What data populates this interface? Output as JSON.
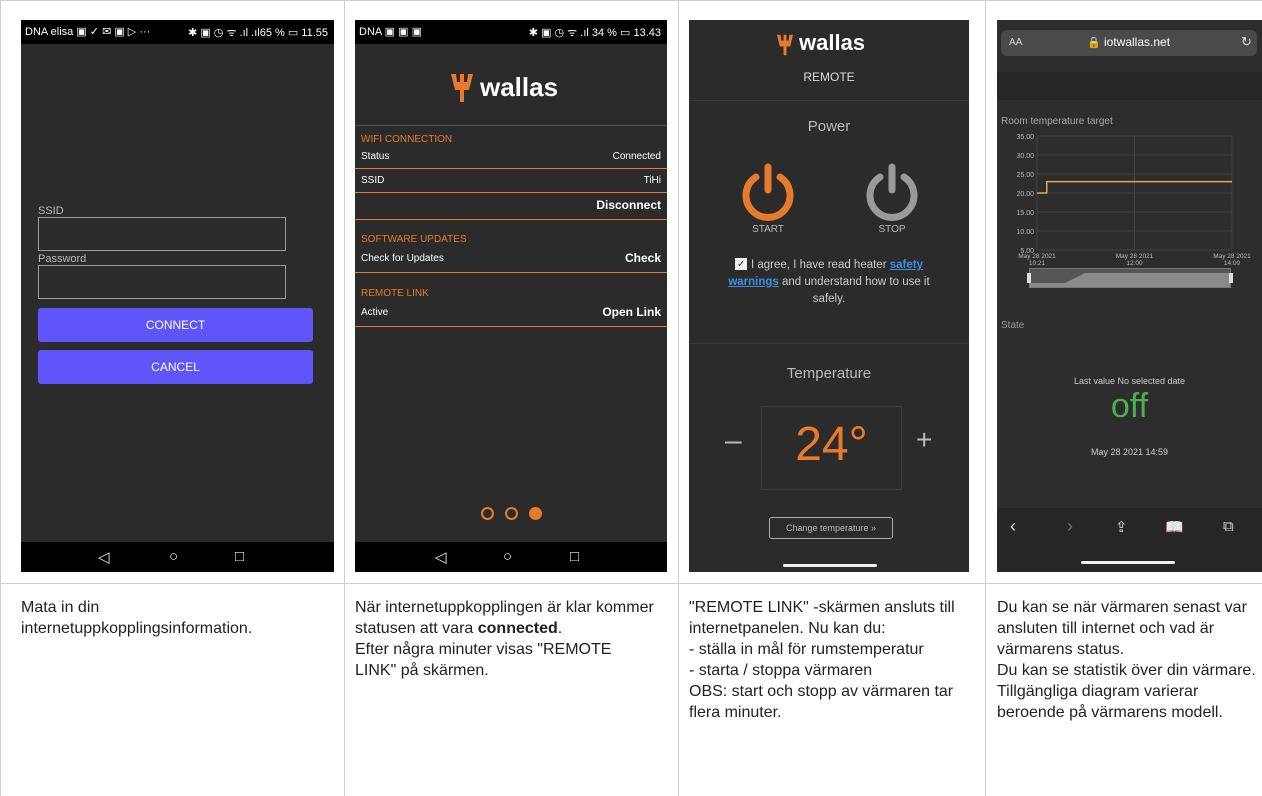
{
  "phone1": {
    "status_left": "DNA elisa ▣ ✓ ✉ ▣ ▷ ···",
    "status_right": "✱ ▣ ◷ ᯤ .ıl .ıl65 % ▭ 11.55",
    "ssid_label": "SSID",
    "password_label": "Password",
    "connect_label": "CONNECT",
    "cancel_label": "CANCEL"
  },
  "phone2": {
    "status_left": "DNA ▣ ▣ ▣",
    "status_right": "✱ ▣ ◷ ᯤ .ıl 34 % ▭ 13.43",
    "brand": "wallas",
    "wifi_section": "WIFI CONNECTION",
    "status_key": "Status",
    "status_val": "Connected",
    "ssid_key": "SSID",
    "ssid_val": "TiHi",
    "disconnect_label": "Disconnect",
    "updates_section": "SOFTWARE UPDATES",
    "check_key": "Check for Updates",
    "check_label": "Check",
    "remote_section": "REMOTE LINK",
    "active_key": "Active",
    "open_link_label": "Open Link"
  },
  "phone3": {
    "brand": "wallas",
    "subtitle": "REMOTE",
    "power_title": "Power",
    "start_label": "START",
    "stop_label": "STOP",
    "agree_text_1": "I agree, I have read heater",
    "safety_link_1": "safety",
    "safety_link_2": "warnings",
    "agree_text_2": "and understand how to use it",
    "agree_text_3": "safely.",
    "temperature_title": "Temperature",
    "minus": "–",
    "plus": "+",
    "temperature_value": "24°",
    "change_button": "Change temperature »"
  },
  "phone4": {
    "text_size": "AA",
    "url": "iotwallas.net",
    "chart_title": "Room temperature target",
    "state_label": "State",
    "last_value_label": "Last value No selected date",
    "state_value": "off",
    "state_time": "May 28 2021 14:59"
  },
  "chart_data": {
    "type": "line",
    "title": "Room temperature target",
    "yticks": [
      "35.00",
      "30.00",
      "25.00",
      "20.00",
      "15.00",
      "10.00",
      "5.00"
    ],
    "ylim": [
      5,
      35
    ],
    "xticks": [
      {
        "date": "May 28 2021",
        "time": "10:21"
      },
      {
        "date": "May 28 2021",
        "time": "12:00"
      },
      {
        "date": "May 28 2021",
        "time": "14:00"
      }
    ],
    "series": [
      {
        "points": [
          [
            0.0,
            20
          ],
          [
            0.05,
            20
          ],
          [
            0.05,
            23
          ],
          [
            1.0,
            23
          ]
        ]
      }
    ],
    "colors": {
      "line": "#e8a94d"
    }
  },
  "captions": {
    "c1": "Mata in din internetuppkopplingsinformation.",
    "c2_a": "När internetuppkopplingen är klar kommer statusen att vara",
    "c2_bold": "connected",
    "c2_b": "Efter några minuter visas \"REMOTE LINK\" på skärmen.",
    "c3_a": "\"REMOTE LINK\" -skärmen ansluts till internetpanelen. Nu kan du:",
    "c3_b": "- ställa in mål för rumstemperatur",
    "c3_c": "- starta / stoppa värmaren",
    "c3_d": "OBS: start och stopp av värmaren tar flera minuter.",
    "c4_a": "Du kan se när värmaren senast var ansluten till internet och vad är värmarens status.",
    "c4_b": "Du kan se statistik över din värmare. Tillgängliga diagram varierar beroende på värmarens modell."
  },
  "colors": {
    "accent": "#e87b2b",
    "button_blue": "#6055fb",
    "state_green": "#4caf50"
  }
}
